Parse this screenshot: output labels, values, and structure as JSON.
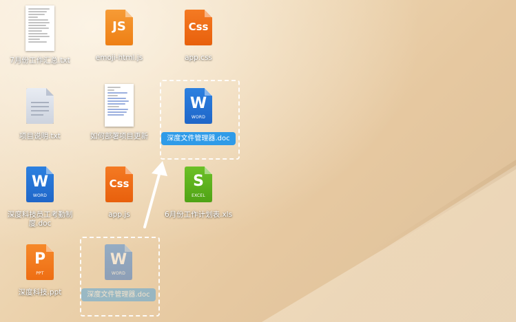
{
  "desktop": {
    "icons": [
      {
        "id": "note-txt",
        "label": "7月份工作汇总.txt",
        "type": "text-page"
      },
      {
        "id": "emoji-js",
        "label": "emoji-html.js",
        "type": "js",
        "glyph": "JS"
      },
      {
        "id": "app-css",
        "label": "app.css",
        "type": "css",
        "glyph": "Css"
      },
      {
        "id": "readme-txt",
        "label": "项目说明.txt",
        "type": "gray-page"
      },
      {
        "id": "deploy-txt",
        "label": "如何部署项目更新",
        "type": "text-page"
      },
      {
        "id": "manager-doc",
        "label": "深度文件管理器.doc",
        "type": "word",
        "glyph": "W",
        "sub": "WORD",
        "selected": true
      },
      {
        "id": "company-doc",
        "label": "深度科技员工考勤制度.doc",
        "type": "word",
        "glyph": "W",
        "sub": "WORD"
      },
      {
        "id": "app-js",
        "label": "app.js",
        "type": "css",
        "glyph": "Css"
      },
      {
        "id": "excel-xls",
        "label": "6月份工作计划表.xls",
        "type": "excel",
        "glyph": "S",
        "sub": "EXCEL"
      },
      {
        "id": "company-ppt",
        "label": "深度科技.ppt",
        "type": "ppt",
        "glyph": "P",
        "sub": "PPT"
      },
      {
        "id": "ghost-doc",
        "label": "深度文件管理器.doc",
        "type": "word",
        "glyph": "W",
        "sub": "WORD",
        "ghost": true
      }
    ]
  }
}
